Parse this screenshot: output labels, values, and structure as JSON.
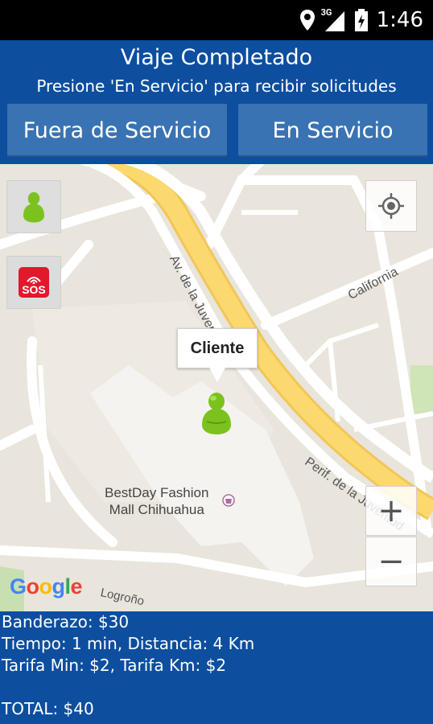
{
  "status_bar": {
    "time": "1:46",
    "network": "3G",
    "icons": [
      "location-icon",
      "signal-icon",
      "battery-icon"
    ]
  },
  "header": {
    "title": "Viaje Completado",
    "subtitle": "Presione 'En Servicio' para recibir solicitudes",
    "off_service_label": "Fuera de Servicio",
    "on_service_label": "En Servicio",
    "bg_color": "#0d4e9f",
    "button_color": "#3a73b3"
  },
  "map": {
    "tooltip": "Cliente",
    "labels": {
      "mall_line1": "BestDay Fashion",
      "mall_line2": "Mall Chihuahua",
      "california": "California",
      "av_juventud": "Av. de la Juven",
      "perif_juventud": "Perif. de la Juventud",
      "logrono": "Logroño"
    },
    "google": [
      "G",
      "o",
      "o",
      "g",
      "l",
      "e"
    ],
    "zoom_in": "+",
    "zoom_out": "−",
    "sos_label": "SOS"
  },
  "info": {
    "banderazo": "Banderazo: $30",
    "tiempo_distancia": "Tiempo: 1 min,  Distancia: 4 Km",
    "tarifas": "Tarifa Min: $2,  Tarifa Km: $2",
    "total": "TOTAL: $40"
  }
}
